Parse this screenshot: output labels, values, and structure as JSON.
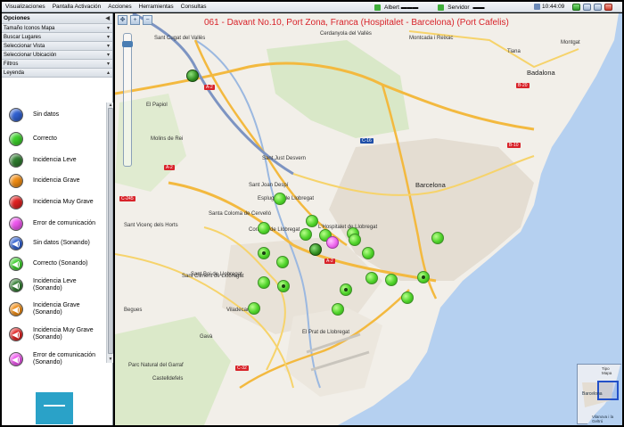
{
  "menubar": {
    "items": [
      "Visualizaciones",
      "Pantalla Activación",
      "Acciones",
      "Herramientas",
      "Consultas"
    ],
    "user": "Albert ▬▬▬",
    "server_label": "Servidor",
    "server_value": "▬▬",
    "time": "10:44:09"
  },
  "leftpanel": {
    "title": "Opciones",
    "sections": [
      "Tamaño Iconos Mapa",
      "Buscar Lugares",
      "Seleccionar Vista",
      "Seleccionar Ubicación",
      "Filtros",
      "Leyenda"
    ],
    "legend": [
      {
        "label": "Sin datos",
        "color": "#2f5fd0",
        "sound": false
      },
      {
        "label": "Correcto",
        "color": "#3ccf2b",
        "sound": false
      },
      {
        "label": "Incidencia Leve",
        "color": "#2e7b2e",
        "sound": false
      },
      {
        "label": "Incidencia Grave",
        "color": "#f08c13",
        "sound": false
      },
      {
        "label": "Incidencia Muy Grave",
        "color": "#e02020",
        "sound": false
      },
      {
        "label": "Error de comunicación",
        "color": "#ee55ee",
        "sound": false
      },
      {
        "label": "Sin datos (Sonando)",
        "color": "#2f5fd0",
        "sound": true
      },
      {
        "label": "Correcto (Sonando)",
        "color": "#3ccf2b",
        "sound": true
      },
      {
        "label": "Incidencia Leve\n(Sonando)",
        "color": "#2e7b2e",
        "sound": true
      },
      {
        "label": "Incidencia Grave\n(Sonando)",
        "color": "#f08c13",
        "sound": true
      },
      {
        "label": "Incidencia Muy Grave\n(Sonando)",
        "color": "#e02020",
        "sound": true
      },
      {
        "label": "Error de comunicación\n(Sonando)",
        "color": "#ee55ee",
        "sound": true
      }
    ]
  },
  "map": {
    "title": "061 - Davant No.10, Port Zona, Franca (Hospitalet - Barcelona) (Port Cafelis)",
    "places": {
      "barcelona": "Barcelona",
      "badalona": "Badalona",
      "hospitalet": "L'Hospitalet de Llobregat",
      "castelldefels": "Castelldefels",
      "sant_cugat": "Sant Cugat del Vallès",
      "sant_boi": "Sant Boi de Llobregat",
      "cornella": "Cornellà de Llobregat",
      "sant_joan": "Sant Joan Despí",
      "santa_coloma": "Santa Coloma de Cervelló",
      "viladecans": "Viladecans",
      "gava": "Gavà",
      "el_prat": "El Prat de Llobregat",
      "sant_climent": "Sant Climent de Llobregat",
      "molins": "Molins de Rei",
      "el_papiol": "El Papiol",
      "sant_vicenc": "Sant Vicenç dels Horts",
      "begues": "Begues",
      "parc_natural": "Parc Natural del Garraf",
      "montgat": "Montgat",
      "tiana": "Tiana",
      "sant_just": "Sant Just Desvern",
      "esplugues": "Esplugues de Llobregat",
      "cerdanyola": "Cerdanyola del Vallès",
      "montcada": "Montcada i Reixac"
    },
    "minimap": {
      "title": "Tipo Mapa",
      "city": "Barcelona",
      "town": "Vilanova i la Geltrú"
    }
  },
  "colors": {
    "title": "#d8232a",
    "sea": "#b5d0f0",
    "marker_green": "#4fd32a",
    "marker_pink": "#ee68ee"
  }
}
